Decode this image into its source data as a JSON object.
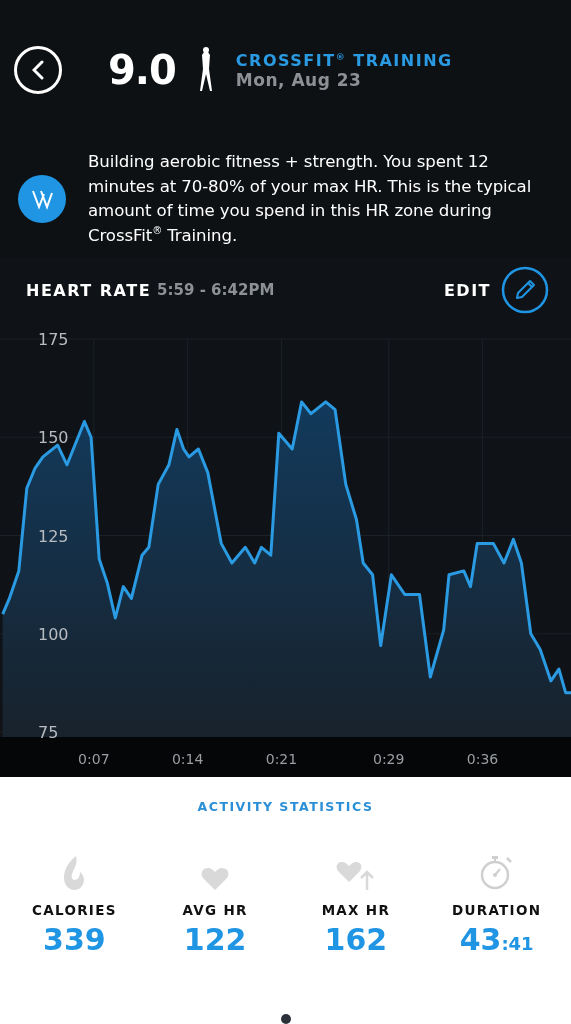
{
  "header": {
    "score": "9.0",
    "activity": "CROSSFIT$^{®}$ TRAINING",
    "date": "Mon, Aug 23"
  },
  "coach_message": "Building aerobic fitness + strength. You spent 12 minutes at 70-80% of your max HR. This is the typical amount of time you spend in this HR zone during CrossFit$^{®}$ Training.",
  "heart_rate": {
    "title": "HEART RATE",
    "time_range": "5:59 - 6:42PM",
    "edit_label": "EDIT",
    "chart_data": {
      "type": "area",
      "grid": true,
      "ylim": [
        75,
        175
      ],
      "xlim": [
        0,
        42.6
      ],
      "yticks": [
        75,
        100,
        125,
        150,
        175
      ],
      "xticks": [
        {
          "value": 7,
          "label": "0:07"
        },
        {
          "value": 14,
          "label": "0:14"
        },
        {
          "value": 21,
          "label": "0:21"
        },
        {
          "value": 29,
          "label": "0:29"
        },
        {
          "value": 36,
          "label": "0:36"
        }
      ],
      "x": [
        0.2,
        0.7,
        1.4,
        2.0,
        2.6,
        3.2,
        4.3,
        5.0,
        6.3,
        6.8,
        7.4,
        8.0,
        8.6,
        9.2,
        9.8,
        10.6,
        11.1,
        11.8,
        12.6,
        13.2,
        13.7,
        14.1,
        14.8,
        15.5,
        16.5,
        17.3,
        18.3,
        19.0,
        19.5,
        20.2,
        20.8,
        21.8,
        22.5,
        23.2,
        24.3,
        25.0,
        25.8,
        26.6,
        27.1,
        27.8,
        28.4,
        29.2,
        30.2,
        31.3,
        32.1,
        33.1,
        33.5,
        34.6,
        35.1,
        35.6,
        36.8,
        37.6,
        38.3,
        38.9,
        39.6,
        40.3,
        41.1,
        41.7,
        42.2,
        42.6
      ],
      "series": [
        {
          "color": "#2a9be3",
          "values": [
            105,
            109,
            116,
            137,
            142,
            145,
            148,
            143,
            154,
            150,
            119,
            113,
            104,
            112,
            109,
            120,
            122,
            138,
            143,
            152,
            147,
            145,
            147,
            141,
            123,
            118,
            122,
            118,
            122,
            120,
            151,
            147,
            159,
            156,
            159,
            157,
            138,
            129,
            118,
            115,
            97,
            115,
            110,
            110,
            89,
            101,
            115,
            116,
            112,
            123,
            123,
            118,
            124,
            118,
            100,
            96,
            88,
            91,
            85,
            85
          ]
        }
      ]
    }
  },
  "statistics": {
    "title": "ACTIVITY STATISTICS",
    "items": [
      {
        "kind": "flame",
        "label": "CALORIES",
        "value": "339"
      },
      {
        "kind": "heart",
        "label": "AVG HR",
        "value": "122"
      },
      {
        "kind": "heart-up",
        "label": "MAX HR",
        "value": "162"
      },
      {
        "kind": "stopwatch",
        "label": "DURATION",
        "value": "43",
        "value_suffix": ":41"
      }
    ]
  },
  "page_dots": [
    {
      "selected": true
    }
  ]
}
